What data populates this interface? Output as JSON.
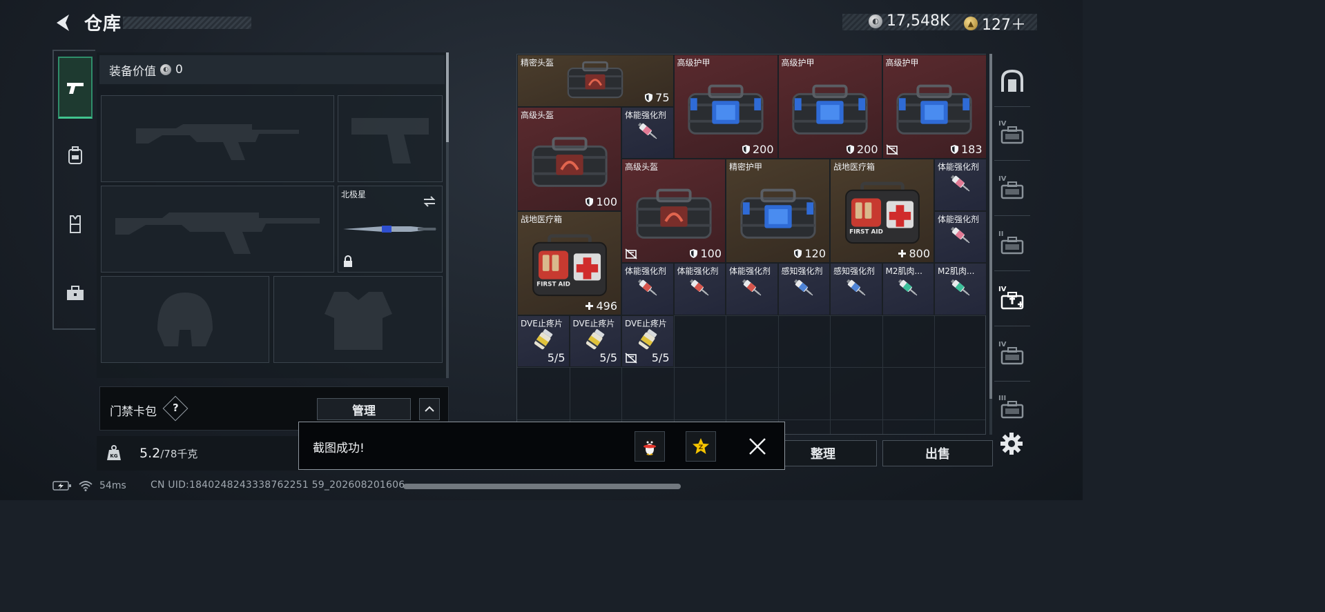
{
  "header": {
    "title": "仓库",
    "currency_primary": "17,548K",
    "currency_secondary": "127＋"
  },
  "left_tabs": [
    {
      "name": "pistol-icon",
      "active": true
    },
    {
      "name": "backpack-icon",
      "active": false
    },
    {
      "name": "vest-icon",
      "active": false
    },
    {
      "name": "toolbox-icon",
      "active": false
    }
  ],
  "equipment": {
    "value_label": "装备价值",
    "value": "0",
    "melee_slot_label": "北极星"
  },
  "access_card": {
    "label": "门禁卡包",
    "help": "?",
    "manage_button": "管理"
  },
  "weight": {
    "current": "5.2",
    "capacity": "/78千克"
  },
  "inventory": {
    "items": [
      {
        "id": "i1",
        "name": "精密头盔",
        "value": "75",
        "type": "durability",
        "color": "gold",
        "nodrop": false,
        "icon": "bag-red"
      },
      {
        "id": "i2",
        "name": "高级护甲",
        "value": "200",
        "type": "durability",
        "color": "red",
        "nodrop": false,
        "icon": "bag-blue"
      },
      {
        "id": "i3",
        "name": "高级护甲",
        "value": "200",
        "type": "durability",
        "color": "red",
        "nodrop": false,
        "icon": "bag-blue"
      },
      {
        "id": "i4",
        "name": "高级护甲",
        "value": "183",
        "type": "durability",
        "color": "red",
        "nodrop": true,
        "icon": "bag-blue"
      },
      {
        "id": "i5",
        "name": "高级头盔",
        "value": "100",
        "type": "durability",
        "color": "red",
        "nodrop": false,
        "icon": "bag-red"
      },
      {
        "id": "i6",
        "name": "体能强化剂",
        "value": "",
        "type": "none",
        "color": "blue",
        "nodrop": false,
        "icon": "syringe-pink"
      },
      {
        "id": "i7",
        "name": "高级头盔",
        "value": "100",
        "type": "durability",
        "color": "red",
        "nodrop": true,
        "icon": "bag-red"
      },
      {
        "id": "i8",
        "name": "精密护甲",
        "value": "120",
        "type": "durability",
        "color": "gold",
        "nodrop": false,
        "icon": "bag-blue"
      },
      {
        "id": "i9",
        "name": "战地医疗箱",
        "value": "800",
        "type": "heal",
        "color": "gold",
        "nodrop": false,
        "icon": "medkit"
      },
      {
        "id": "i10",
        "name": "体能强化剂",
        "value": "",
        "type": "none",
        "color": "blue",
        "nodrop": false,
        "icon": "syringe-pink"
      },
      {
        "id": "i11",
        "name": "体能强化剂",
        "value": "",
        "type": "none",
        "color": "blue",
        "nodrop": false,
        "icon": "syringe-pink"
      },
      {
        "id": "i12",
        "name": "战地医疗箱",
        "value": "496",
        "type": "heal",
        "color": "gold",
        "nodrop": false,
        "icon": "medkit"
      },
      {
        "id": "i13",
        "name": "体能强化剂",
        "value": "",
        "type": "none",
        "color": "blue",
        "nodrop": false,
        "icon": "syringe-red"
      },
      {
        "id": "i14",
        "name": "体能强化剂",
        "value": "",
        "type": "none",
        "color": "blue",
        "nodrop": false,
        "icon": "syringe-red"
      },
      {
        "id": "i15",
        "name": "体能强化剂",
        "value": "",
        "type": "none",
        "color": "blue",
        "nodrop": false,
        "icon": "syringe-red"
      },
      {
        "id": "i16",
        "name": "感知强化剂",
        "value": "",
        "type": "none",
        "color": "blue",
        "nodrop": false,
        "icon": "syringe-blue"
      },
      {
        "id": "i17",
        "name": "感知强化剂",
        "value": "",
        "type": "none",
        "color": "blue",
        "nodrop": false,
        "icon": "syringe-blue"
      },
      {
        "id": "i18",
        "name": "M2肌肉...",
        "value": "",
        "type": "none",
        "color": "blue",
        "nodrop": false,
        "icon": "syringe-green"
      },
      {
        "id": "i19",
        "name": "M2肌肉...",
        "value": "",
        "type": "none",
        "color": "blue",
        "nodrop": false,
        "icon": "syringe-green"
      },
      {
        "id": "i20",
        "name": "DVE止疼片",
        "value": "5/5",
        "type": "count",
        "color": "blue",
        "nodrop": false,
        "icon": "pills"
      },
      {
        "id": "i21",
        "name": "DVE止疼片",
        "value": "5/5",
        "type": "count",
        "color": "blue",
        "nodrop": false,
        "icon": "pills"
      },
      {
        "id": "i22",
        "name": "DVE止疼片",
        "value": "5/5",
        "type": "count",
        "color": "blue",
        "nodrop": true,
        "icon": "pills"
      }
    ]
  },
  "right_tabs": [
    {
      "name": "safe-box-tab",
      "level": ""
    },
    {
      "name": "rifle-case-tab",
      "level": "IV"
    },
    {
      "name": "ammo-box-tab",
      "level": "IV"
    },
    {
      "name": "gun-case-tab",
      "level": "II"
    },
    {
      "name": "medical-box-tab",
      "level": "IV"
    },
    {
      "name": "armor-case-tab",
      "level": "IV"
    },
    {
      "name": "weapon-rack-tab",
      "level": "III"
    }
  ],
  "actions": {
    "sort_button": "整理",
    "sell_button": "出售"
  },
  "toast": {
    "message": "截图成功!"
  },
  "status_bar": {
    "latency": "54ms",
    "uid": "CN UID:1840248243338762251 59_202608201606"
  },
  "colors": {
    "accent_green": "#41c48e",
    "rarity_red": "#5a2a2e",
    "rarity_gold": "#4b3d2c",
    "rarity_blue": "#2d3142"
  }
}
